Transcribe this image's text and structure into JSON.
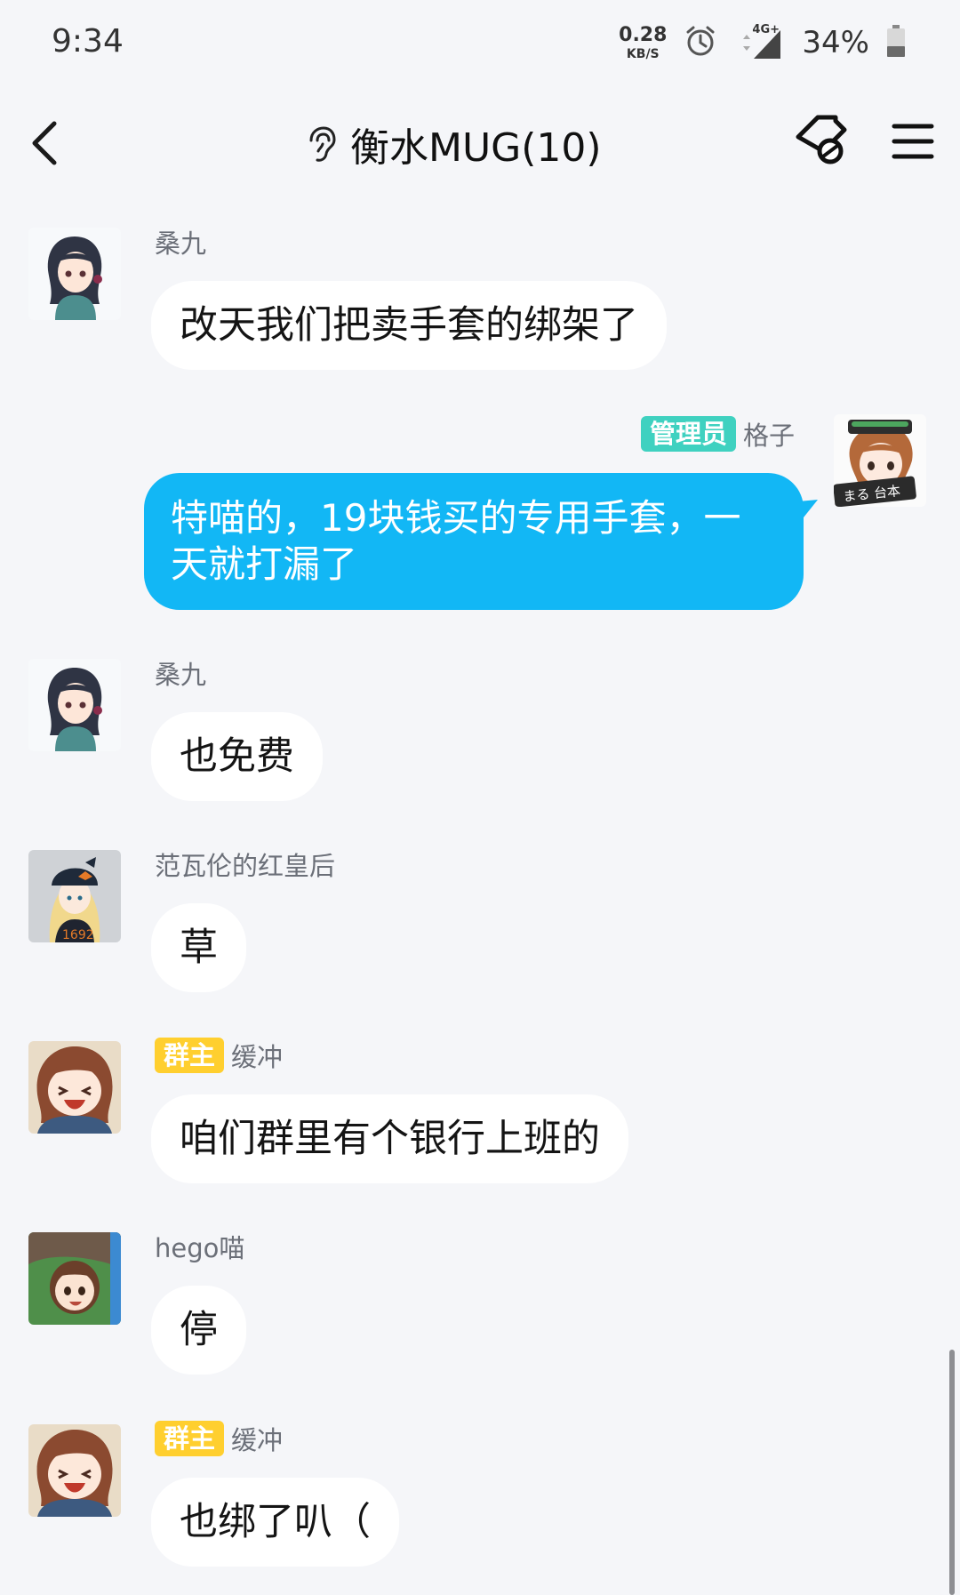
{
  "status_bar": {
    "time": "9:34",
    "net_speed_value": "0.28",
    "net_speed_unit": "KB/S",
    "network": "4G+",
    "battery": "34%"
  },
  "header": {
    "title": "衡水MUG(10)"
  },
  "messages": [
    {
      "sender": "桑九",
      "text": "改天我们把卖手套的绑架了",
      "side": "left"
    },
    {
      "sender": "格子",
      "badge": "管理员",
      "text": "特喵的，19块钱买的专用手套，一天就打漏了",
      "side": "right"
    },
    {
      "sender": "桑九",
      "text": "也免费",
      "side": "left"
    },
    {
      "sender": "范瓦伦的红皇后",
      "text": "草",
      "side": "left"
    },
    {
      "sender": "缓冲",
      "badge": "群主",
      "text": "咱们群里有个银行上班的",
      "side": "left"
    },
    {
      "sender": "hego喵",
      "text": "停",
      "side": "left"
    },
    {
      "sender": "缓冲",
      "badge": "群主",
      "text": "也绑了叭（",
      "side": "left"
    }
  ],
  "colors": {
    "background": "#f5f6f9",
    "my_bubble": "#12b7f5",
    "admin_badge": "#3fd1c0",
    "owner_badge": "#ffcf2f"
  }
}
